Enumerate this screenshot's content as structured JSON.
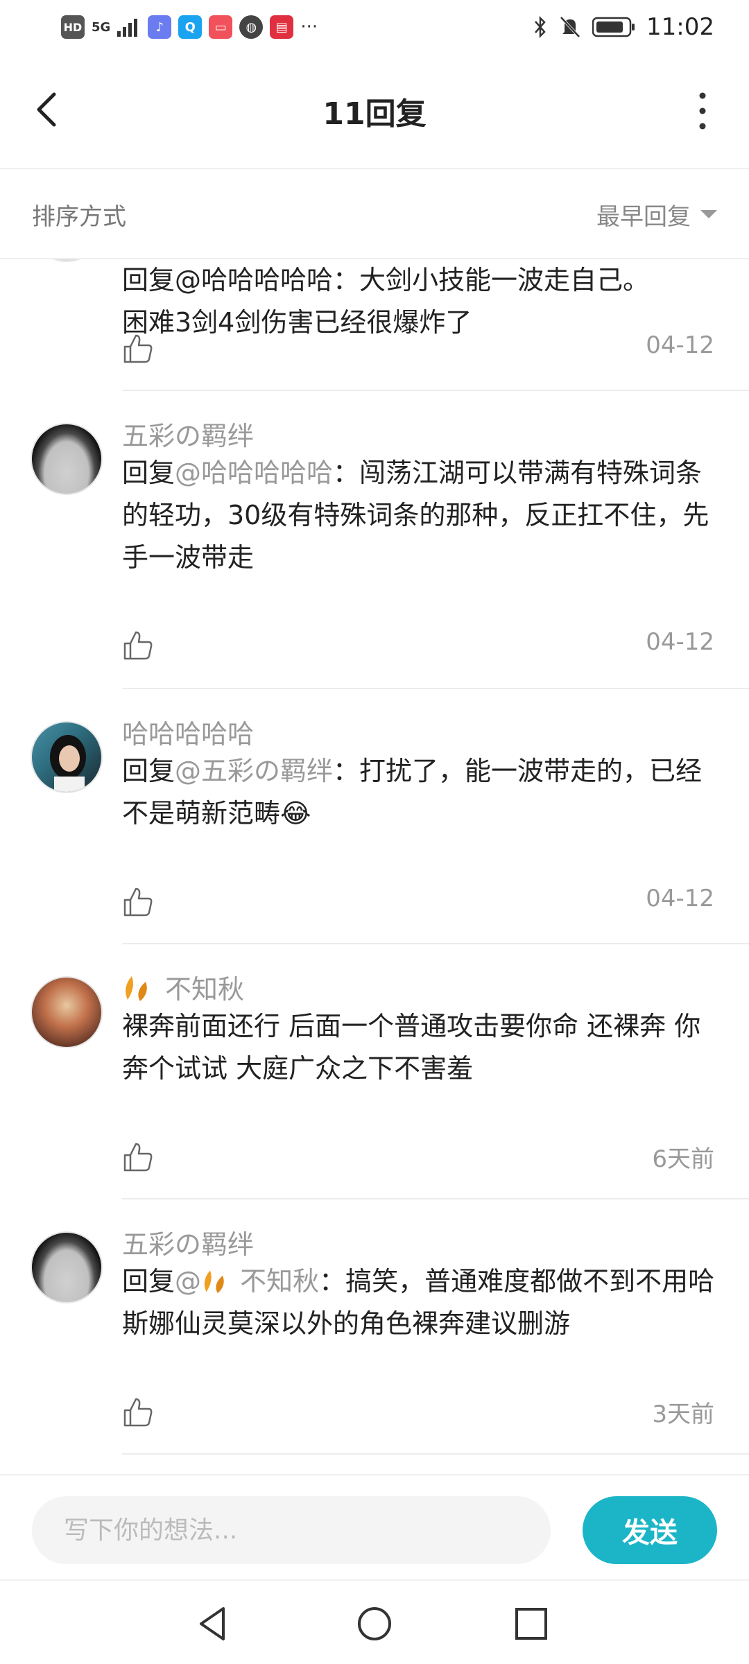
{
  "status_bar": {
    "time": "11:02",
    "hd_label": "HD",
    "network_label": "5G",
    "more_label": "···"
  },
  "header": {
    "title": "11回复"
  },
  "sort": {
    "label": "排序方式",
    "value": "最早回复"
  },
  "comments": [
    {
      "text_line1": "回复@哈哈哈哈哈：大剑小技能一波走自己。",
      "text_line2": "困难3剑4剑伤害已经很爆炸了",
      "date": "04-12"
    },
    {
      "username": "五彩の羁绊",
      "reply_prefix": "回复",
      "mention": "@哈哈哈哈哈",
      "text": "：闯荡江湖可以带满有特殊词条的轻功，30级有特殊词条的那种，反正扛不住，先手一波带走",
      "date": "04-12"
    },
    {
      "username": "哈哈哈哈哈",
      "reply_prefix": "回复",
      "mention": "@五彩の羁绊",
      "text": "：打扰了，能一波带走的，已经不是萌新范畴😂",
      "date": "04-12"
    },
    {
      "username": "不知秋",
      "text": "裸奔前面还行 后面一个普通攻击要你命 还裸奔 你奔个试试 大庭广众之下不害羞",
      "date": "6天前"
    },
    {
      "username": "五彩の羁绊",
      "reply_prefix": "回复",
      "mention": "@",
      "mention_name": " 不知秋",
      "text": "：搞笑，普通难度都做不到不用哈斯娜仙灵莫深以外的角色裸奔建议删游",
      "date": "3天前"
    }
  ],
  "input": {
    "placeholder": "写下你的想法..."
  },
  "send_button": {
    "label": "发送"
  },
  "colors": {
    "accent": "#1bb5c7",
    "muted": "#999999"
  }
}
